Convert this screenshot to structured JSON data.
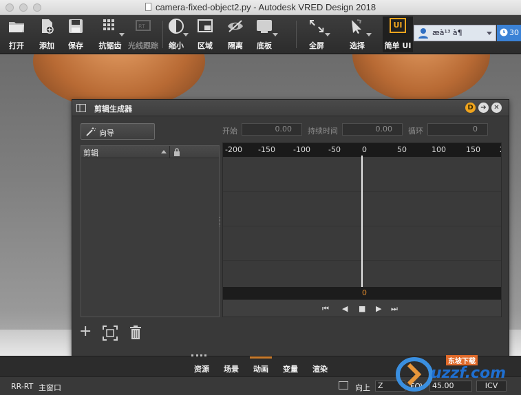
{
  "window": {
    "title": "camera-fixed-object2.py - Autodesk VRED Design 2018"
  },
  "toolbar": {
    "open": "打开",
    "add": "添加",
    "save": "保存",
    "antialias": "抗锯齿",
    "raytracing": "光线跟踪",
    "zoom": "缩小",
    "region": "区域",
    "isolate": "隔离",
    "floor": "底板",
    "fullscreen": "全屏",
    "select": "选择",
    "simple_ui": "简单 UI",
    "ui_icon": "UI",
    "user_name": "æà¹³ à¶",
    "notifications": "30"
  },
  "dialog": {
    "title": "剪辑生成器",
    "d_badge": "D",
    "wizard_label": "向导",
    "start_label": "开始",
    "start_value": "0.00",
    "duration_label": "持续时间",
    "duration_value": "0.00",
    "loop_label": "循环",
    "loop_value": "0",
    "clips_header": "剪辑",
    "ruler": [
      "-200",
      "-150",
      "-100",
      "-50",
      "0",
      "50",
      "100",
      "150",
      "2"
    ],
    "current_frame": "0"
  },
  "tabs": [
    "资源",
    "场景",
    "动画",
    "变量",
    "渲染"
  ],
  "status": {
    "render_mode": "RR-RT",
    "window_name": "主窗口",
    "up_label": "向上",
    "up_value": "Z",
    "fov_label": "FOV",
    "fov_value": "45.00",
    "icv": "ICV"
  },
  "watermark": {
    "text": "uzzf.com",
    "sub": "东坡下载"
  },
  "colors": {
    "accent_orange": "#e08a2c",
    "user_badge": "#3b82d6",
    "simple_ui": "#f0a41d"
  }
}
